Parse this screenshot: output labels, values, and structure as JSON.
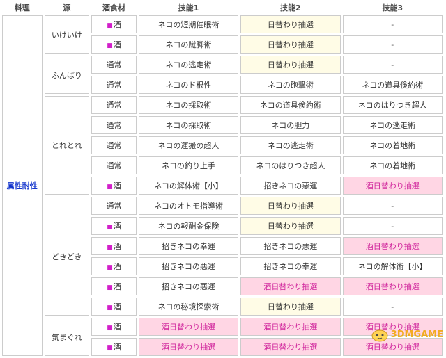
{
  "headers": {
    "dish": "料理",
    "source": "源",
    "ingredient": "酒食材",
    "skill1": "技能1",
    "skill2": "技能2",
    "skill3": "技能3"
  },
  "category": "属性耐性",
  "ingredient_marker": "■",
  "groups": [
    {
      "source": "いけいけ",
      "rows": [
        {
          "ingredient": "酒",
          "sake": true,
          "s1": "ネコの短期催眠術",
          "s2": "日替わり抽選",
          "s3": "-"
        },
        {
          "ingredient": "酒",
          "sake": true,
          "s1": "ネコの蹴脚術",
          "s2": "日替わり抽選",
          "s3": "-"
        }
      ]
    },
    {
      "source": "ふんばり",
      "rows": [
        {
          "ingredient": "通常",
          "sake": false,
          "s1": "ネコの逃走術",
          "s2": "日替わり抽選",
          "s3": "-"
        },
        {
          "ingredient": "通常",
          "sake": false,
          "s1": "ネコのド根性",
          "s2": "ネコの砲撃術",
          "s3": "ネコの道具倹約術"
        }
      ]
    },
    {
      "source": "とれとれ",
      "rows": [
        {
          "ingredient": "通常",
          "sake": false,
          "s1": "ネコの採取術",
          "s2": "ネコの道具倹約術",
          "s3": "ネコのはりつき超人"
        },
        {
          "ingredient": "通常",
          "sake": false,
          "s1": "ネコの採取術",
          "s2": "ネコの胆力",
          "s3": "ネコの逃走術"
        },
        {
          "ingredient": "通常",
          "sake": false,
          "s1": "ネコの運搬の超人",
          "s2": "ネコの逃走術",
          "s3": "ネコの着地術"
        },
        {
          "ingredient": "通常",
          "sake": false,
          "s1": "ネコの釣り上手",
          "s2": "ネコのはりつき超人",
          "s3": "ネコの着地術"
        },
        {
          "ingredient": "酒",
          "sake": true,
          "s1": "ネコの解体術【小】",
          "s2": "招きネコの悪運",
          "s3": "酒日替わり抽選"
        }
      ]
    },
    {
      "source": "どきどき",
      "rows": [
        {
          "ingredient": "通常",
          "sake": false,
          "s1": "ネコのオトモ指導術",
          "s2": "日替わり抽選",
          "s3": "-"
        },
        {
          "ingredient": "酒",
          "sake": true,
          "s1": "ネコの報酬金保険",
          "s2": "日替わり抽選",
          "s3": "-"
        },
        {
          "ingredient": "酒",
          "sake": true,
          "s1": "招きネコの幸運",
          "s2": "招きネコの悪運",
          "s3": "酒日替わり抽選"
        },
        {
          "ingredient": "酒",
          "sake": true,
          "s1": "招きネコの悪運",
          "s2": "招きネコの幸運",
          "s3": "ネコの解体術【小】"
        },
        {
          "ingredient": "酒",
          "sake": true,
          "s1": "招きネコの悪運",
          "s2": "酒日替わり抽選",
          "s3": "酒日替わり抽選"
        },
        {
          "ingredient": "酒",
          "sake": true,
          "s1": "ネコの秘境探索術",
          "s2": "日替わり抽選",
          "s3": "-"
        }
      ]
    },
    {
      "source": "気まぐれ",
      "rows": [
        {
          "ingredient": "酒",
          "sake": true,
          "s1": "酒日替わり抽選",
          "s2": "酒日替わり抽選",
          "s3": "酒日替わり抽選"
        },
        {
          "ingredient": "酒",
          "sake": true,
          "s1": "酒日替わり抽選",
          "s2": "酒日替わり抽選",
          "s3": "酒日替わり抽選"
        }
      ]
    }
  ],
  "watermark": "3DMGAME",
  "colors": {
    "category_text": "#1133cc",
    "sake_marker": "#d21fc9",
    "daily_lottery_bg": "#fffce6",
    "sake_lottery_bg": "#ffd6e4",
    "sake_lottery_text": "#d0259c",
    "border": "#cccccc"
  }
}
